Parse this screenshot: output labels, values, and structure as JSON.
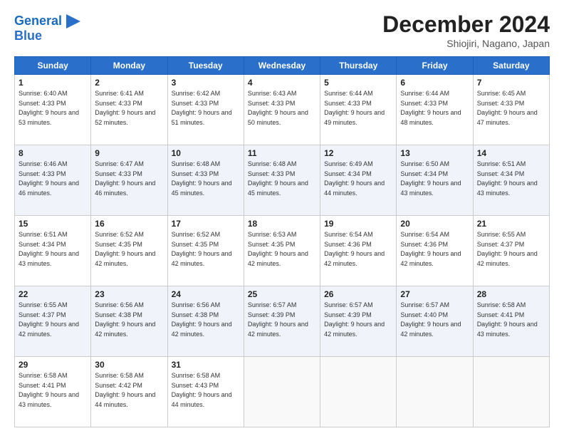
{
  "header": {
    "logo_line1": "General",
    "logo_line2": "Blue",
    "month": "December 2024",
    "location": "Shiojiri, Nagano, Japan"
  },
  "days_of_week": [
    "Sunday",
    "Monday",
    "Tuesday",
    "Wednesday",
    "Thursday",
    "Friday",
    "Saturday"
  ],
  "weeks": [
    [
      {
        "day": "1",
        "sunrise": "6:40 AM",
        "sunset": "4:33 PM",
        "daylight": "9 hours and 53 minutes."
      },
      {
        "day": "2",
        "sunrise": "6:41 AM",
        "sunset": "4:33 PM",
        "daylight": "9 hours and 52 minutes."
      },
      {
        "day": "3",
        "sunrise": "6:42 AM",
        "sunset": "4:33 PM",
        "daylight": "9 hours and 51 minutes."
      },
      {
        "day": "4",
        "sunrise": "6:43 AM",
        "sunset": "4:33 PM",
        "daylight": "9 hours and 50 minutes."
      },
      {
        "day": "5",
        "sunrise": "6:44 AM",
        "sunset": "4:33 PM",
        "daylight": "9 hours and 49 minutes."
      },
      {
        "day": "6",
        "sunrise": "6:44 AM",
        "sunset": "4:33 PM",
        "daylight": "9 hours and 48 minutes."
      },
      {
        "day": "7",
        "sunrise": "6:45 AM",
        "sunset": "4:33 PM",
        "daylight": "9 hours and 47 minutes."
      }
    ],
    [
      {
        "day": "8",
        "sunrise": "6:46 AM",
        "sunset": "4:33 PM",
        "daylight": "9 hours and 46 minutes."
      },
      {
        "day": "9",
        "sunrise": "6:47 AM",
        "sunset": "4:33 PM",
        "daylight": "9 hours and 46 minutes."
      },
      {
        "day": "10",
        "sunrise": "6:48 AM",
        "sunset": "4:33 PM",
        "daylight": "9 hours and 45 minutes."
      },
      {
        "day": "11",
        "sunrise": "6:48 AM",
        "sunset": "4:33 PM",
        "daylight": "9 hours and 45 minutes."
      },
      {
        "day": "12",
        "sunrise": "6:49 AM",
        "sunset": "4:34 PM",
        "daylight": "9 hours and 44 minutes."
      },
      {
        "day": "13",
        "sunrise": "6:50 AM",
        "sunset": "4:34 PM",
        "daylight": "9 hours and 43 minutes."
      },
      {
        "day": "14",
        "sunrise": "6:51 AM",
        "sunset": "4:34 PM",
        "daylight": "9 hours and 43 minutes."
      }
    ],
    [
      {
        "day": "15",
        "sunrise": "6:51 AM",
        "sunset": "4:34 PM",
        "daylight": "9 hours and 43 minutes."
      },
      {
        "day": "16",
        "sunrise": "6:52 AM",
        "sunset": "4:35 PM",
        "daylight": "9 hours and 42 minutes."
      },
      {
        "day": "17",
        "sunrise": "6:52 AM",
        "sunset": "4:35 PM",
        "daylight": "9 hours and 42 minutes."
      },
      {
        "day": "18",
        "sunrise": "6:53 AM",
        "sunset": "4:35 PM",
        "daylight": "9 hours and 42 minutes."
      },
      {
        "day": "19",
        "sunrise": "6:54 AM",
        "sunset": "4:36 PM",
        "daylight": "9 hours and 42 minutes."
      },
      {
        "day": "20",
        "sunrise": "6:54 AM",
        "sunset": "4:36 PM",
        "daylight": "9 hours and 42 minutes."
      },
      {
        "day": "21",
        "sunrise": "6:55 AM",
        "sunset": "4:37 PM",
        "daylight": "9 hours and 42 minutes."
      }
    ],
    [
      {
        "day": "22",
        "sunrise": "6:55 AM",
        "sunset": "4:37 PM",
        "daylight": "9 hours and 42 minutes."
      },
      {
        "day": "23",
        "sunrise": "6:56 AM",
        "sunset": "4:38 PM",
        "daylight": "9 hours and 42 minutes."
      },
      {
        "day": "24",
        "sunrise": "6:56 AM",
        "sunset": "4:38 PM",
        "daylight": "9 hours and 42 minutes."
      },
      {
        "day": "25",
        "sunrise": "6:57 AM",
        "sunset": "4:39 PM",
        "daylight": "9 hours and 42 minutes."
      },
      {
        "day": "26",
        "sunrise": "6:57 AM",
        "sunset": "4:39 PM",
        "daylight": "9 hours and 42 minutes."
      },
      {
        "day": "27",
        "sunrise": "6:57 AM",
        "sunset": "4:40 PM",
        "daylight": "9 hours and 42 minutes."
      },
      {
        "day": "28",
        "sunrise": "6:58 AM",
        "sunset": "4:41 PM",
        "daylight": "9 hours and 43 minutes."
      }
    ],
    [
      {
        "day": "29",
        "sunrise": "6:58 AM",
        "sunset": "4:41 PM",
        "daylight": "9 hours and 43 minutes."
      },
      {
        "day": "30",
        "sunrise": "6:58 AM",
        "sunset": "4:42 PM",
        "daylight": "9 hours and 44 minutes."
      },
      {
        "day": "31",
        "sunrise": "6:58 AM",
        "sunset": "4:43 PM",
        "daylight": "9 hours and 44 minutes."
      },
      null,
      null,
      null,
      null
    ]
  ]
}
